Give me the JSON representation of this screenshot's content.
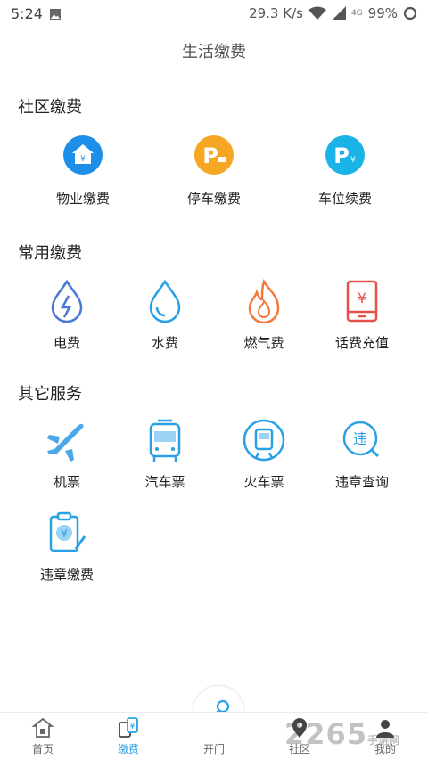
{
  "status_bar": {
    "time": "5:24",
    "speed": "29.3 K/s",
    "battery": "99%",
    "network": "4G"
  },
  "page_title": "生活缴费",
  "sections": [
    {
      "title": "社区缴费",
      "items": [
        {
          "label": "物业缴费",
          "icon": "property-fee-icon"
        },
        {
          "label": "停车缴费",
          "icon": "parking-fee-icon"
        },
        {
          "label": "车位续费",
          "icon": "parking-space-renewal-icon"
        }
      ]
    },
    {
      "title": "常用缴费",
      "items": [
        {
          "label": "电费",
          "icon": "electricity-icon"
        },
        {
          "label": "水费",
          "icon": "water-icon"
        },
        {
          "label": "燃气费",
          "icon": "gas-icon"
        },
        {
          "label": "话费充值",
          "icon": "phone-recharge-icon"
        }
      ]
    },
    {
      "title": "其它服务",
      "items": [
        {
          "label": "机票",
          "icon": "airplane-icon"
        },
        {
          "label": "汽车票",
          "icon": "bus-icon"
        },
        {
          "label": "火车票",
          "icon": "train-icon"
        },
        {
          "label": "违章查询",
          "icon": "violation-query-icon"
        },
        {
          "label": "违章缴费",
          "icon": "violation-payment-icon"
        }
      ]
    }
  ],
  "tabs": [
    {
      "label": "首页",
      "icon": "home-icon"
    },
    {
      "label": "缴费",
      "icon": "payment-icon",
      "active": true
    },
    {
      "label": "开门",
      "icon": "key-icon"
    },
    {
      "label": "社区",
      "icon": "community-icon"
    },
    {
      "label": "我的",
      "icon": "profile-icon"
    }
  ],
  "watermark": {
    "brand": "2265",
    "sub": "手游网"
  },
  "colors": {
    "accent": "#2aa0e6",
    "blue_fill": "#1e8fe8",
    "orange": "#f5a623",
    "teal": "#1ab3e8",
    "red": "#e6504a",
    "gas": "#f07a3c"
  }
}
